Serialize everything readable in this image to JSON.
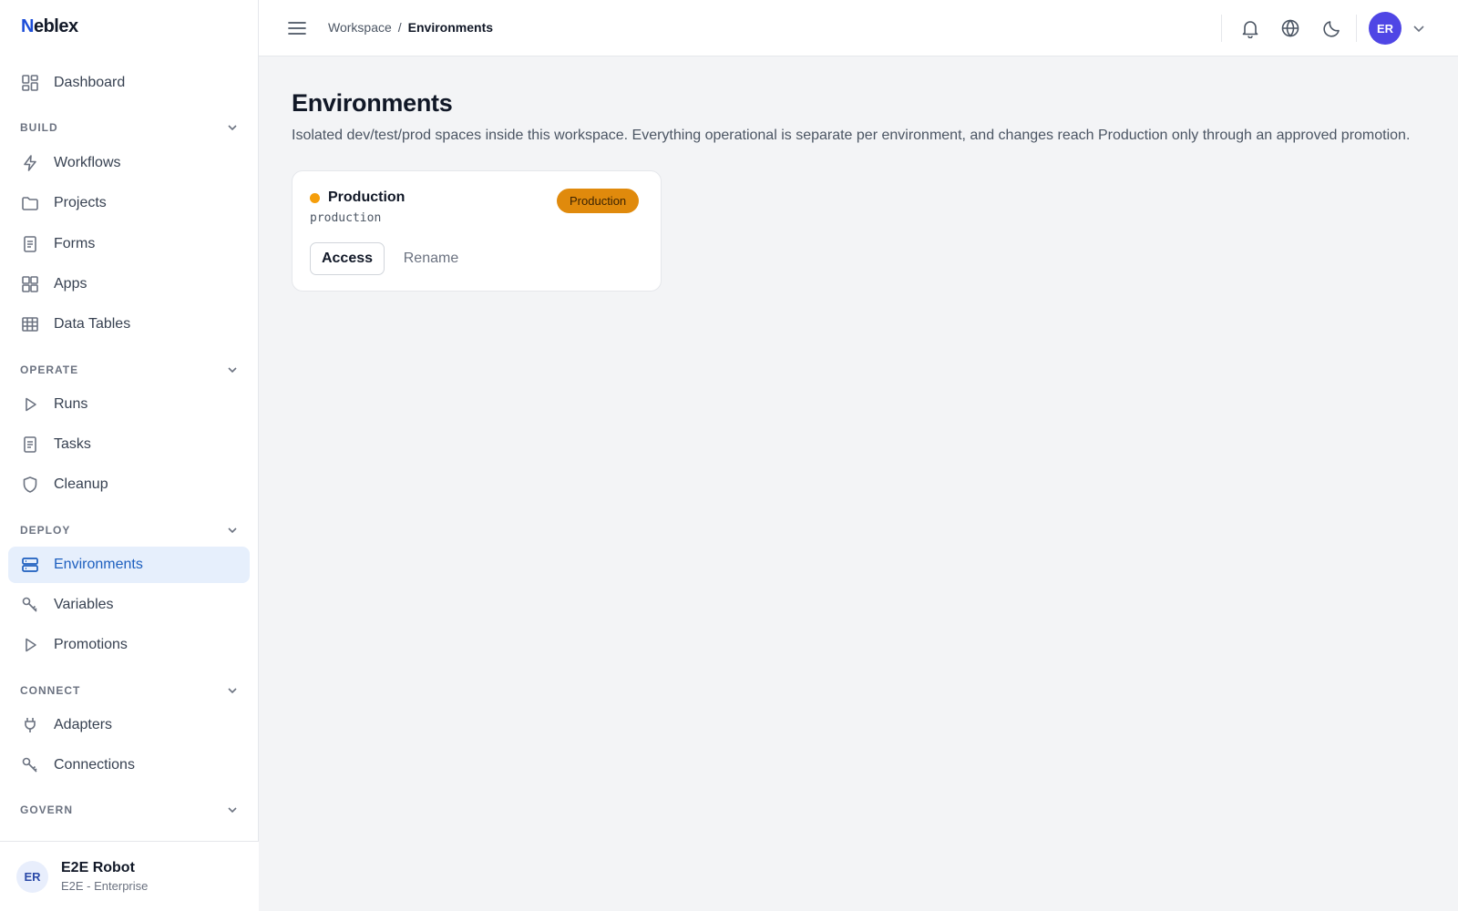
{
  "brand": {
    "logo_letter": "N",
    "logo_rest": "eblex"
  },
  "sidebar": {
    "dashboard": "Dashboard",
    "sections": {
      "build": "BUILD",
      "operate": "OPERATE",
      "deploy": "DEPLOY",
      "connect": "CONNECT",
      "govern": "GOVERN"
    },
    "items": {
      "workflows": "Workflows",
      "projects": "Projects",
      "forms": "Forms",
      "apps": "Apps",
      "data_tables": "Data Tables",
      "runs": "Runs",
      "tasks": "Tasks",
      "cleanup": "Cleanup",
      "environments": "Environments",
      "variables": "Variables",
      "promotions": "Promotions",
      "adapters": "Adapters",
      "connections": "Connections"
    },
    "active_item": "environments",
    "user": {
      "initials": "ER",
      "name": "E2E Robot",
      "org": "E2E - Enterprise"
    }
  },
  "header": {
    "breadcrumb": {
      "parent": "Workspace",
      "separator": "/",
      "current": "Environments"
    },
    "avatar_initials": "ER",
    "icons": [
      "menu-icon",
      "bell-icon",
      "globe-icon",
      "moon-icon",
      "chevron-down-icon"
    ]
  },
  "main": {
    "title": "Environments",
    "description": "Isolated dev/test/prod spaces inside this workspace. Everything operational is separate per environment, and changes reach Production only through an approved promotion.",
    "environments": [
      {
        "name": "Production",
        "slug": "production",
        "badge": "Production",
        "status_color": "#f59e0b",
        "actions": {
          "access": "Access",
          "rename": "Rename"
        }
      }
    ]
  },
  "colors": {
    "accent": "#1d5fbf",
    "active_bg": "#e6effc",
    "avatar": "#4f46e5",
    "badge": "#e08a0c"
  }
}
